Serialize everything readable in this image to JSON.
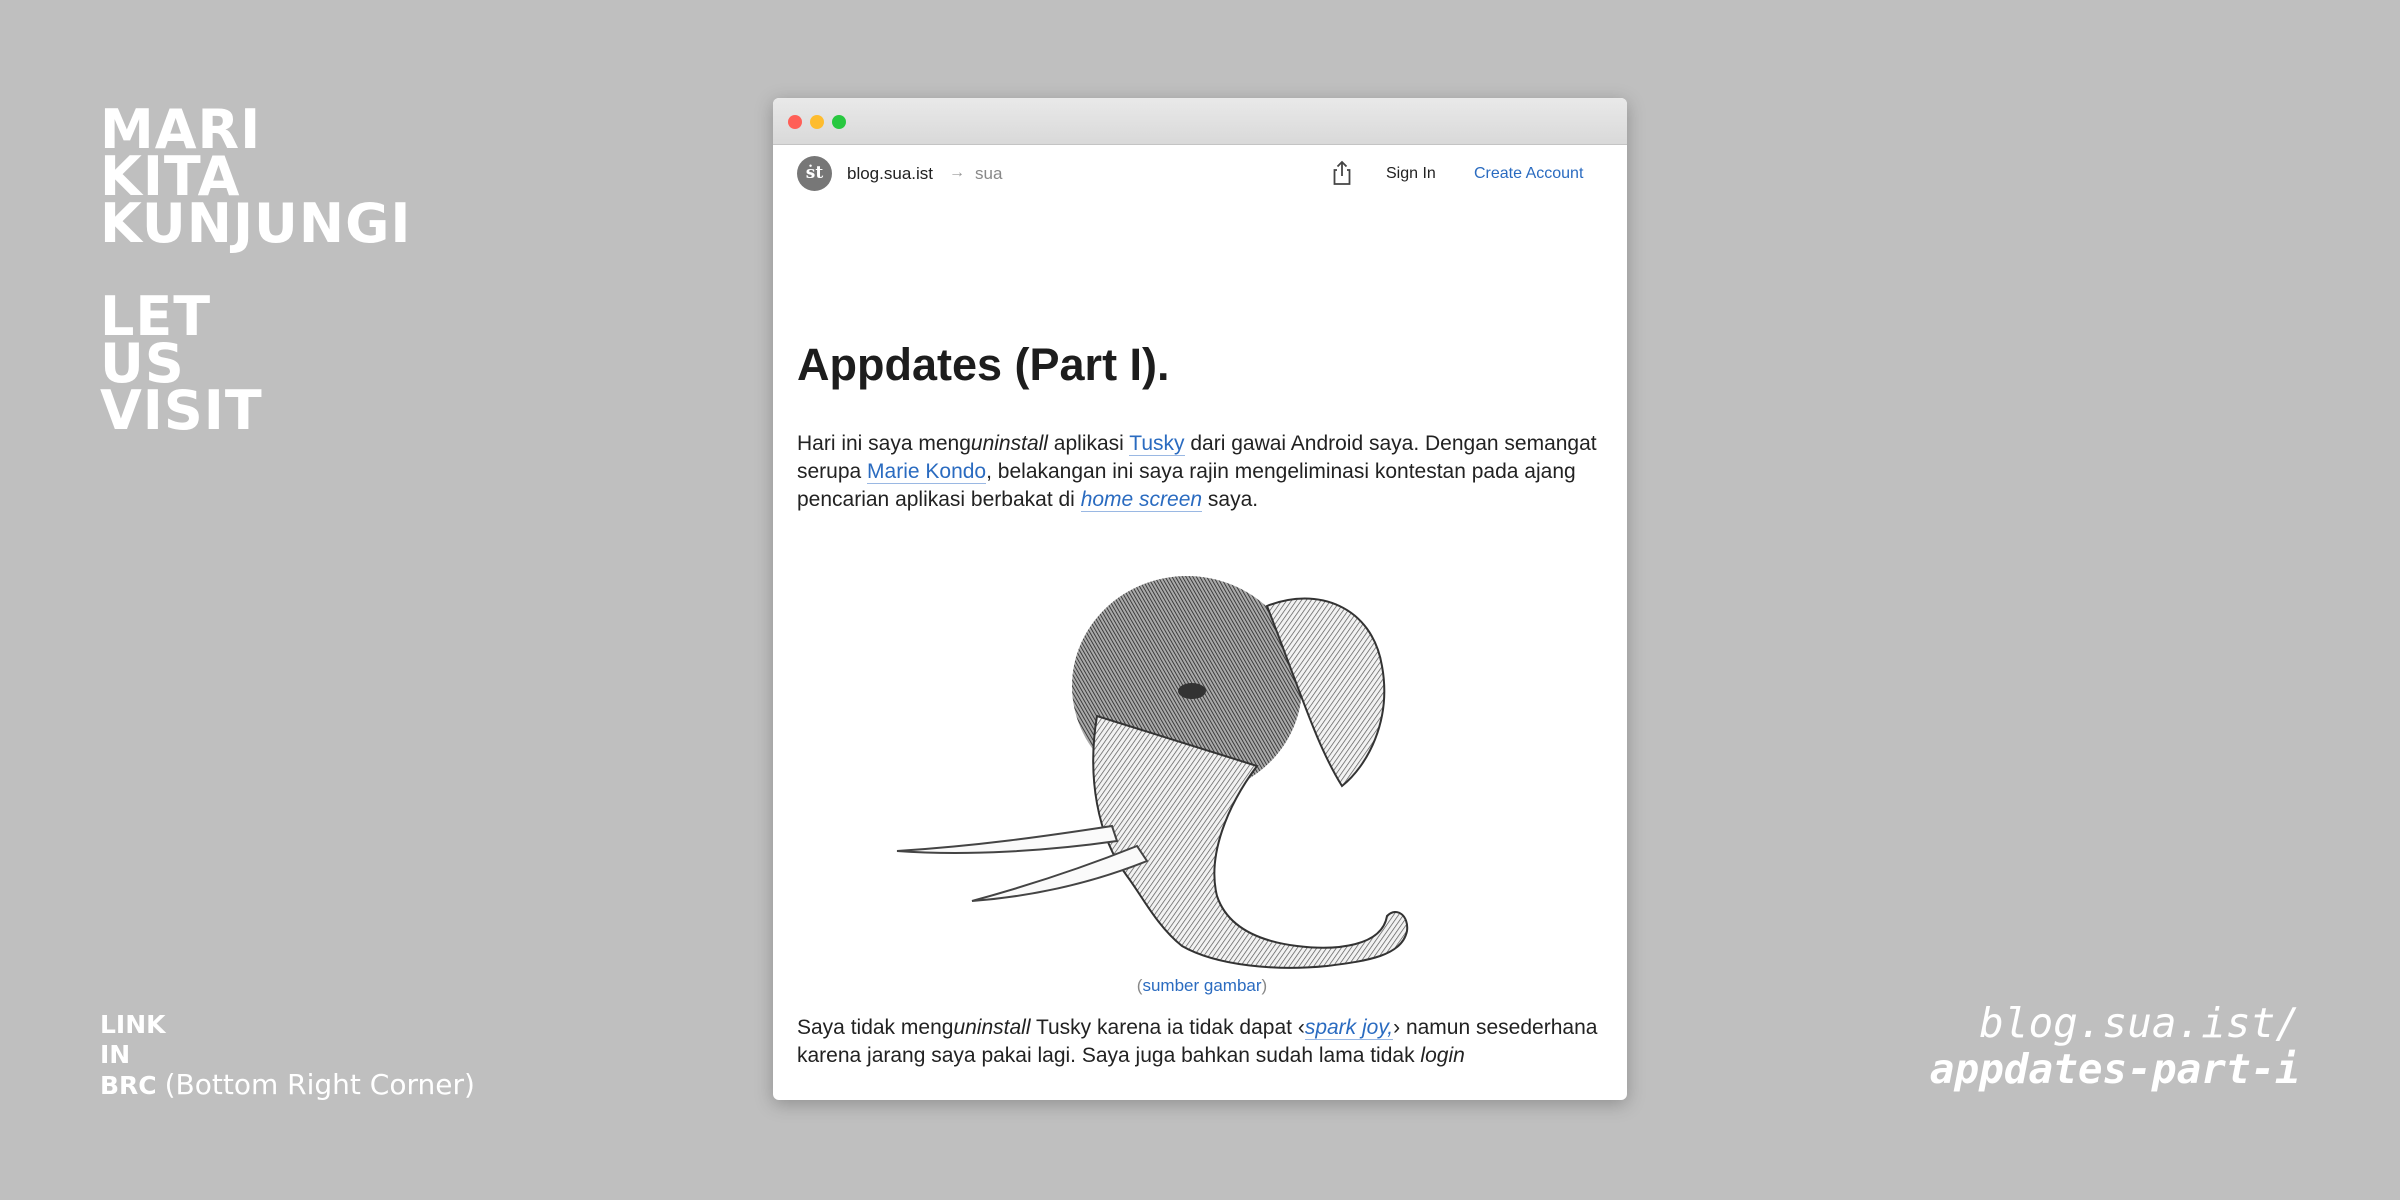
{
  "left": {
    "title_lines": [
      "MARI",
      "KITA",
      "KUNJUNGI"
    ],
    "title_lines_en": [
      "LET",
      "US",
      "VISIT"
    ],
    "link_note": {
      "line1": "LINK",
      "line2": "IN",
      "line3_bold": "BRC",
      "line3_light": "(Bottom Right Corner)"
    }
  },
  "url": {
    "line1": "blog.sua.ist/",
    "line2": "appdates-part-i"
  },
  "browser": {
    "logo_text": "ṡt",
    "site": "blog.sua.ist",
    "arrow": "→",
    "sub": "sua",
    "share_icon": "share-icon",
    "sign_in": "Sign In",
    "create_account": "Create Account"
  },
  "post": {
    "title": "Appdates (Part I).",
    "p1": {
      "t1": "Hari ini saya meng",
      "t1_em": "uninstall",
      "t2": " aplikasi ",
      "link_tusky": "Tusky",
      "t3": " dari gawai Android saya. Dengan semangat serupa ",
      "link_marie": "Marie Kondo",
      "t4": ", belakangan ini saya rajin mengeliminasi kontestan pada ajang pencarian aplikasi berbakat di ",
      "link_home": "home screen",
      "t5": " saya."
    },
    "image_alt": "elephant-illustration",
    "caption": {
      "open": "(",
      "link": "sumber gambar",
      "close": ")"
    },
    "p2": {
      "t1": "Saya tidak meng",
      "t1_em": "uninstall",
      "t2": " Tusky karena ia tidak dapat ‹",
      "link_spark": "spark joy,",
      "t3": "› namun sesederhana karena jarang saya pakai lagi. Saya juga bahkan sudah lama tidak ",
      "t3_em": "login"
    }
  },
  "colors": {
    "background": "#bfbfbf",
    "link": "#2a6bc0",
    "accent_blue": "#2a6bc0"
  }
}
